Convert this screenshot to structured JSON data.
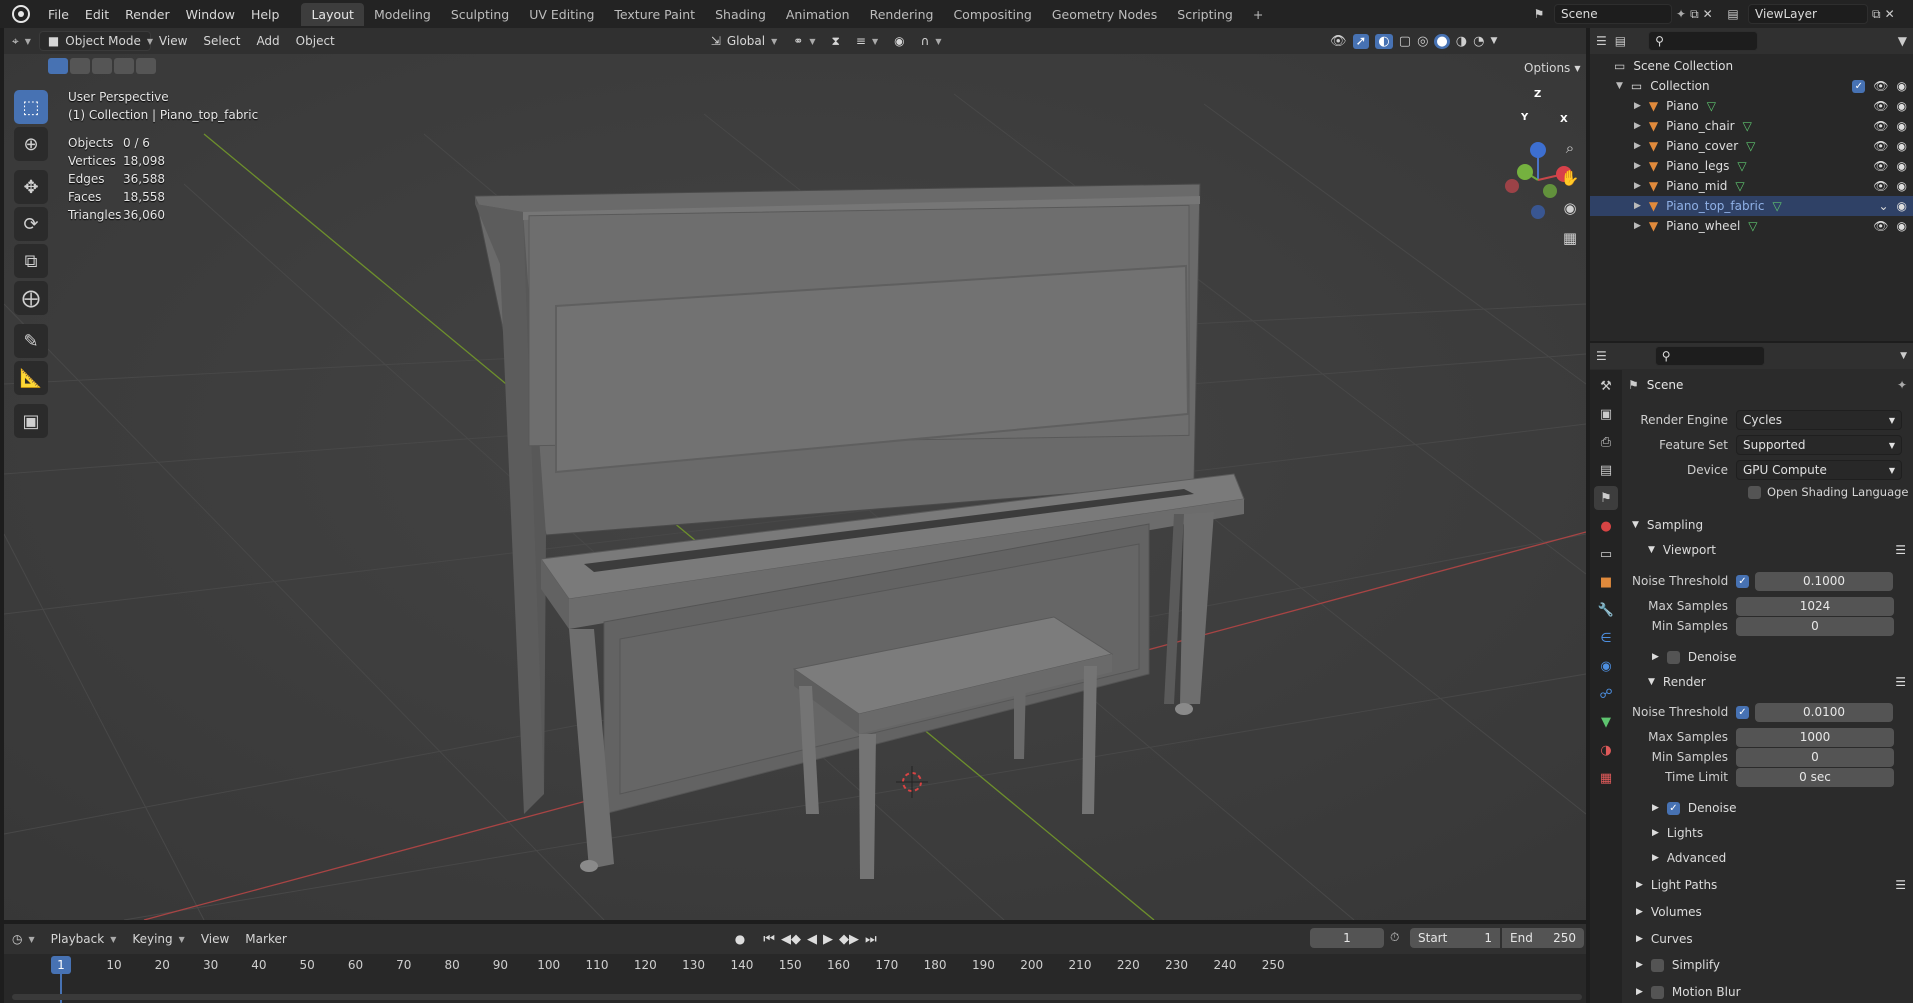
{
  "topbar": {
    "menus": [
      "File",
      "Edit",
      "Render",
      "Window",
      "Help"
    ],
    "workspaces": [
      "Layout",
      "Modeling",
      "Sculpting",
      "UV Editing",
      "Texture Paint",
      "Shading",
      "Animation",
      "Rendering",
      "Compositing",
      "Geometry Nodes",
      "Scripting"
    ],
    "active_workspace": "Layout",
    "add_tab": "+",
    "scene_name": "Scene",
    "view_layer": "ViewLayer"
  },
  "viewport_header": {
    "mode": "Object Mode",
    "menus": [
      "View",
      "Select",
      "Add",
      "Object"
    ],
    "orientation": "Global",
    "options": "Options"
  },
  "viewport": {
    "perspective": "User Perspective",
    "collection_path": "(1) Collection | Piano_top_fabric",
    "stats": [
      {
        "label": "Objects",
        "value": "0 / 6"
      },
      {
        "label": "Vertices",
        "value": "18,098"
      },
      {
        "label": "Edges",
        "value": "36,588"
      },
      {
        "label": "Faces",
        "value": "18,558"
      },
      {
        "label": "Triangles",
        "value": "36,060"
      }
    ],
    "gizmo": {
      "z": "Z",
      "y": "Y",
      "x": "X"
    }
  },
  "toolbar": {
    "tools": [
      "select-box-icon",
      "cursor-icon",
      "move-icon",
      "rotate-icon",
      "scale-icon",
      "transform-icon",
      "annotate-icon",
      "measure-icon",
      "add-cube-icon"
    ]
  },
  "timeline": {
    "menus": [
      "Playback",
      "Keying",
      "View",
      "Marker"
    ],
    "current_frame": "1",
    "start_label": "Start",
    "start": "1",
    "end_label": "End",
    "end": "250",
    "ruler_ticks": [
      "10",
      "20",
      "30",
      "40",
      "50",
      "60",
      "70",
      "80",
      "90",
      "100",
      "110",
      "120",
      "130",
      "140",
      "150",
      "160",
      "170",
      "180",
      "190",
      "200",
      "210",
      "220",
      "230",
      "240",
      "250"
    ],
    "playhead": "1"
  },
  "outliner": {
    "scene_collection": "Scene Collection",
    "collection": "Collection",
    "objects": [
      "Piano",
      "Piano_chair",
      "Piano_cover",
      "Piano_legs",
      "Piano_mid",
      "Piano_top_fabric",
      "Piano_wheel"
    ],
    "selected": "Piano_top_fabric"
  },
  "properties": {
    "context_title": "Scene",
    "render_engine_label": "Render Engine",
    "render_engine": "Cycles",
    "feature_set_label": "Feature Set",
    "feature_set": "Supported",
    "device_label": "Device",
    "device": "GPU Compute",
    "osl_label": "Open Shading Language",
    "sampling": "Sampling",
    "viewport": "Viewport",
    "vp_noise_threshold_label": "Noise Threshold",
    "vp_noise_threshold": "0.1000",
    "vp_max_samples_label": "Max Samples",
    "vp_max_samples": "1024",
    "vp_min_samples_label": "Min Samples",
    "vp_min_samples": "0",
    "vp_denoise": "Denoise",
    "render": "Render",
    "r_noise_threshold_label": "Noise Threshold",
    "r_noise_threshold": "0.0100",
    "r_max_samples_label": "Max Samples",
    "r_max_samples": "1000",
    "r_min_samples_label": "Min Samples",
    "r_min_samples": "0",
    "r_time_limit_label": "Time Limit",
    "r_time_limit": "0 sec",
    "r_denoise": "Denoise",
    "lights": "Lights",
    "advanced": "Advanced",
    "light_paths": "Light Paths",
    "volumes": "Volumes",
    "curves": "Curves",
    "simplify": "Simplify",
    "motion_blur": "Motion Blur"
  },
  "colors": {
    "accent": "#4772b3",
    "x_axis": "#b44a4a",
    "y_axis": "#6f8f2e",
    "object_icon": "#e08a3c",
    "mesh_icon": "#5ec46f"
  }
}
